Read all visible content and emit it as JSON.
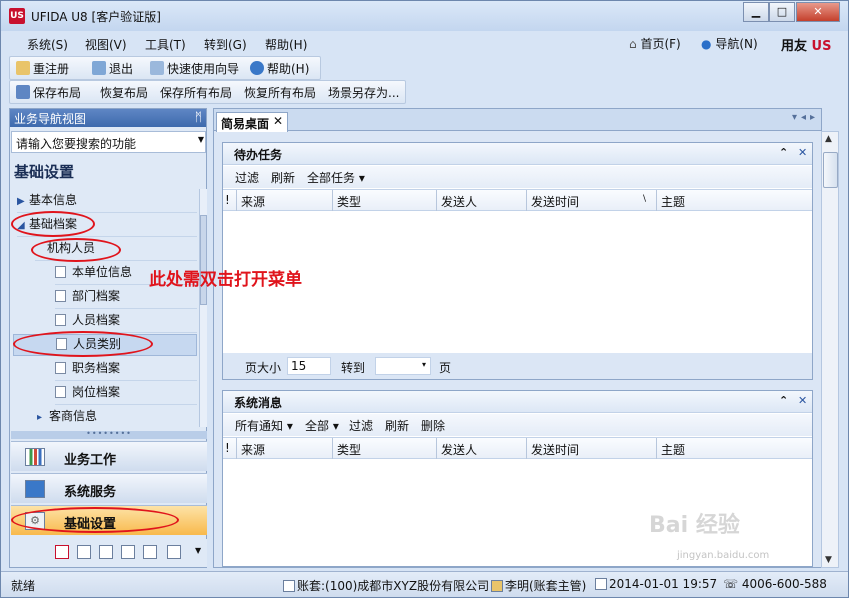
{
  "window": {
    "title": "UFIDA U8 [客户验证版]",
    "logo_text": "US",
    "min": "▁",
    "max": "□",
    "close": "✕"
  },
  "menu": {
    "items": [
      "系统(S)",
      "视图(V)",
      "工具(T)",
      "转到(G)",
      "帮助(H)"
    ],
    "home": "首页(F)",
    "nav": "导航(N)",
    "brand": "用友"
  },
  "toolbar1": {
    "relogin": "重注册",
    "exit": "退出",
    "wizard": "快速使用向导",
    "help": "帮助(H)"
  },
  "toolbar2": {
    "save_layout": "保存布局",
    "restore_layout": "恢复布局",
    "save_all": "保存所有布局",
    "restore_all": "恢复所有布局",
    "save_scene": "场景另存为..."
  },
  "nav_pane": {
    "header": "业务导航视图",
    "pin": "ᛗ",
    "search_placeholder": "请输入您要搜索的功能",
    "section_title": "基础设置",
    "tree": [
      {
        "label": "基本信息",
        "level": 0,
        "expander": "▶"
      },
      {
        "label": "基础档案",
        "level": 0,
        "expander": "◢"
      },
      {
        "label": "机构人员",
        "level": 1,
        "expander": ""
      },
      {
        "label": "本单位信息",
        "level": 2,
        "expander": ""
      },
      {
        "label": "部门档案",
        "level": 2,
        "expander": ""
      },
      {
        "label": "人员档案",
        "level": 2,
        "expander": ""
      },
      {
        "label": "人员类别",
        "level": 2,
        "expander": ""
      },
      {
        "label": "职务档案",
        "level": 2,
        "expander": ""
      },
      {
        "label": "岗位档案",
        "level": 2,
        "expander": ""
      },
      {
        "label": "客商信息",
        "level": 1,
        "expander": "▸"
      }
    ],
    "splitter": "••••••••",
    "modules": [
      "业务工作",
      "系统服务",
      "基础设置"
    ]
  },
  "annotation": "此处需双击打开菜单",
  "content": {
    "tab_label": "简易桌面",
    "tab_close": "✕",
    "tab_nav": "▾◂▸",
    "todo": {
      "title": "待办任务",
      "collapse": "⌃",
      "close": "✕",
      "tools": [
        "过滤",
        "刷新",
        "全部任务 ▾"
      ],
      "columns": [
        "!",
        "来源",
        "类型",
        "发送人",
        "发送时间",
        "主题"
      ],
      "sort_mark": "\\",
      "page_size_label": "页大小",
      "page_size_value": "15",
      "goto_label": "转到",
      "goto_arrow": "▾",
      "page_label": "页"
    },
    "messages": {
      "title": "系统消息",
      "collapse": "⌃",
      "close": "✕",
      "tools": [
        "所有通知 ▾",
        "全部 ▾",
        "过滤",
        "刷新",
        "删除"
      ],
      "columns": [
        "!",
        "来源",
        "类型",
        "发送人",
        "发送时间",
        "主题"
      ]
    }
  },
  "status": {
    "ready": "就绪",
    "account": "账套:(100)成都市XYZ股份有限公司",
    "user": "李明(账套主管)",
    "date": "2014-01-01 19:57",
    "phone": "4006-600-588"
  },
  "watermark": {
    "text": "Bai 经验",
    "url": "jingyan.baidu.com"
  },
  "colors": {
    "accent": "#c8102e",
    "annotation": "#e0141c",
    "header_blue": "#3d6aad"
  }
}
